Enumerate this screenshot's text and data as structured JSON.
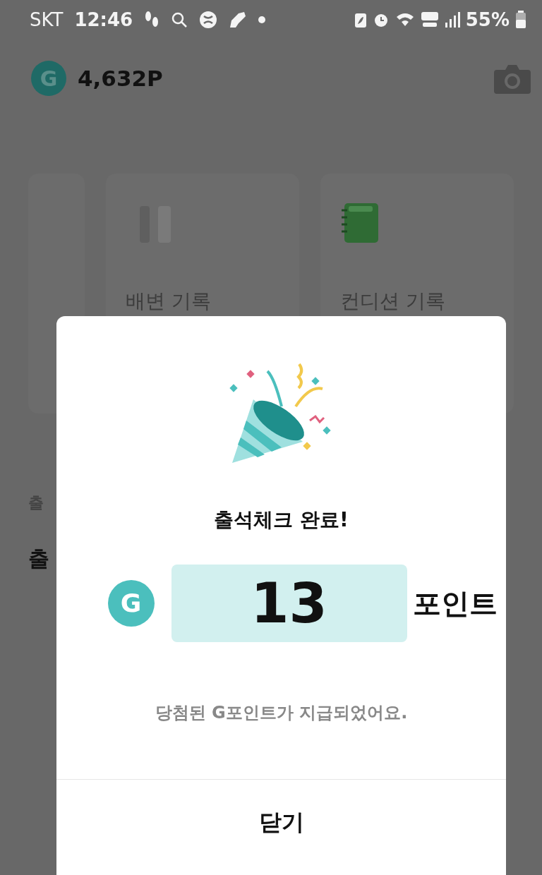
{
  "status_bar": {
    "carrier": "SKT",
    "time": "12:46",
    "battery": "55%"
  },
  "header": {
    "points": "4,632P",
    "g_mark": "G"
  },
  "cards": [
    {
      "label": "배변 기록",
      "kind": "blank"
    },
    {
      "label": "컨디션 기록",
      "kind": "notebook"
    }
  ],
  "section": {
    "caption": "출",
    "heading": "출"
  },
  "modal": {
    "title": "출석체크 완료!",
    "g_mark": "G",
    "amount": "13",
    "unit": "포인트",
    "message": "당첨된 G포인트가 지급되었어요.",
    "close_button": "닫기"
  }
}
